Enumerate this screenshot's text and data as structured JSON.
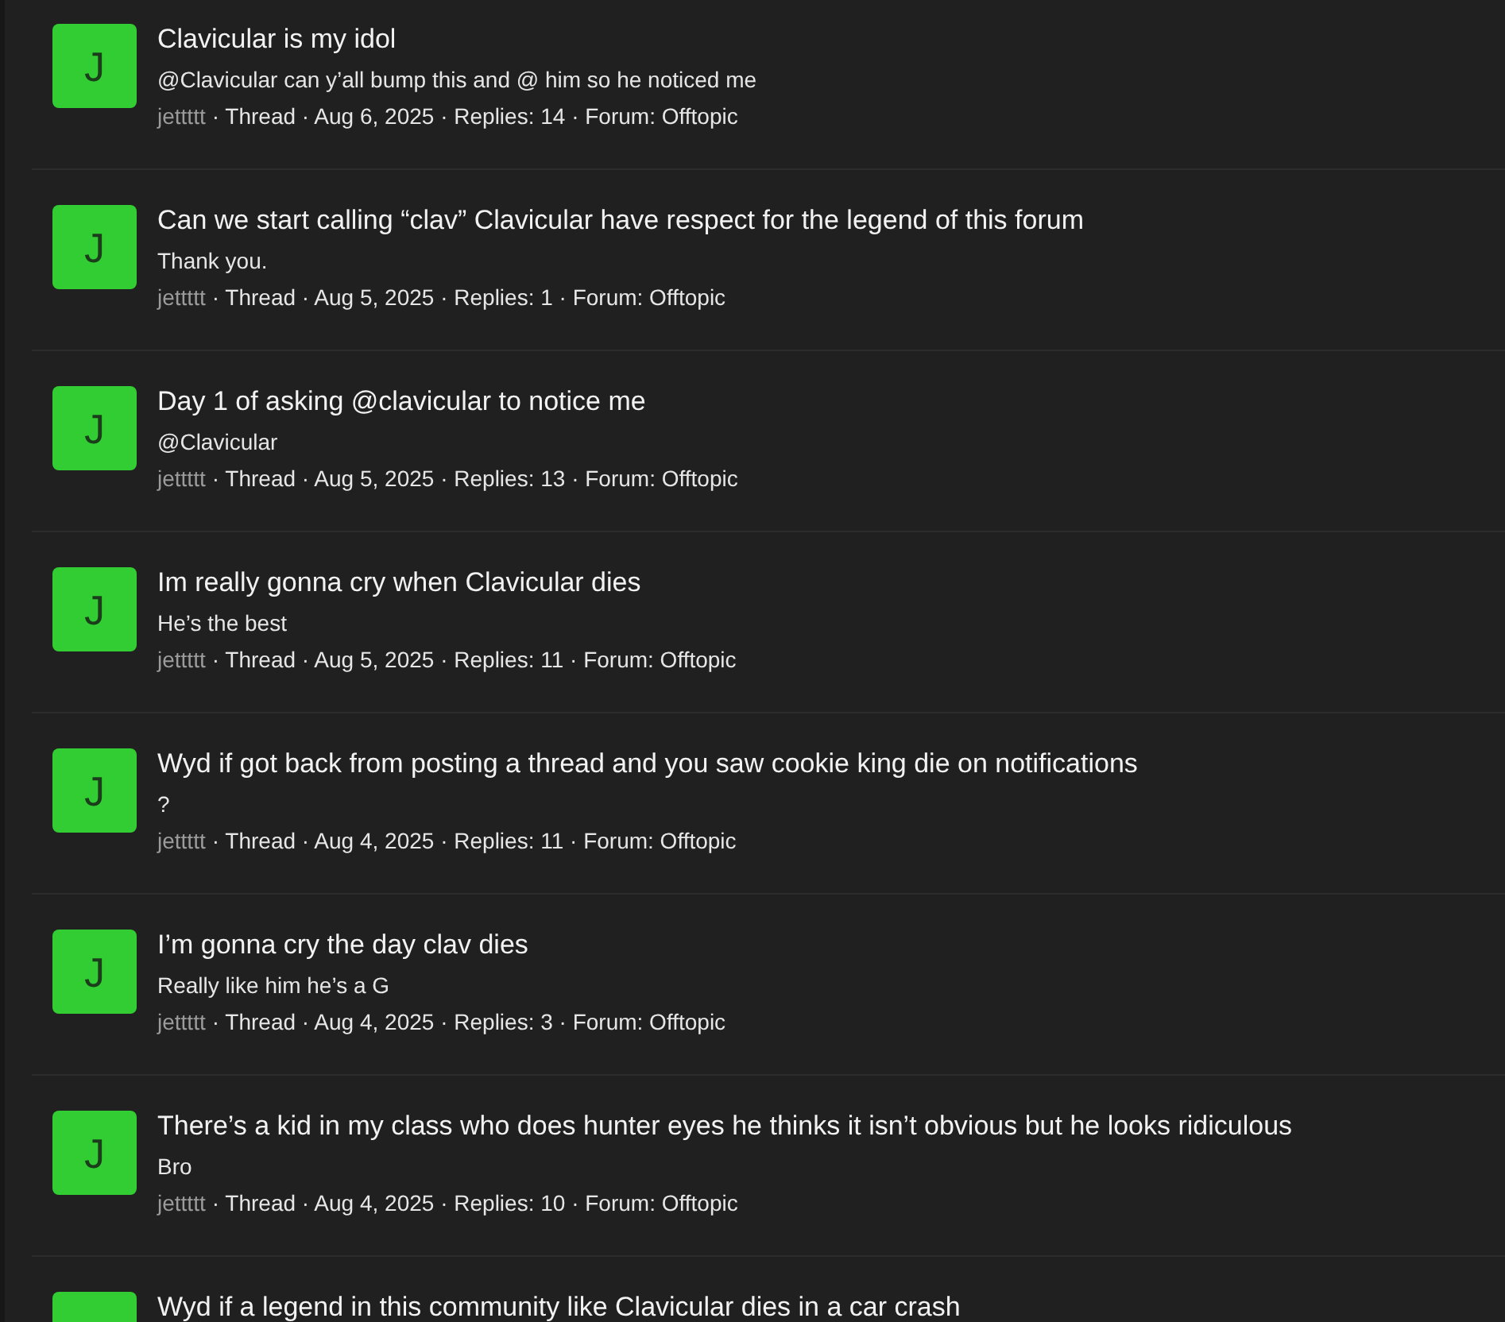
{
  "threads": [
    {
      "avatar_letter": "J",
      "title": "Clavicular is my idol",
      "snippet": "@Clavicular can y’all bump this and @ him so he noticed me",
      "author": "jettttt",
      "details": "· Thread · Aug 6, 2025 · Replies: 14 · Forum: Offtopic"
    },
    {
      "avatar_letter": "J",
      "title": "Can we start calling “clav” Clavicular have respect for the legend of this forum",
      "snippet": "Thank you.",
      "author": "jettttt",
      "details": "· Thread · Aug 5, 2025 · Replies: 1 · Forum: Offtopic"
    },
    {
      "avatar_letter": "J",
      "title": "Day 1 of asking @clavicular to notice me",
      "snippet": "@Clavicular",
      "author": "jettttt",
      "details": "· Thread · Aug 5, 2025 · Replies: 13 · Forum: Offtopic"
    },
    {
      "avatar_letter": "J",
      "title": "Im really gonna cry when Clavicular dies",
      "snippet": "He’s the best",
      "author": "jettttt",
      "details": "· Thread · Aug 5, 2025 · Replies: 11 · Forum: Offtopic"
    },
    {
      "avatar_letter": "J",
      "title": "Wyd if got back from posting a thread and you saw cookie king die on notifications",
      "snippet": "?",
      "author": "jettttt",
      "details": "· Thread · Aug 4, 2025 · Replies: 11 · Forum: Offtopic"
    },
    {
      "avatar_letter": "J",
      "title": "I’m gonna cry the day clav dies",
      "snippet": "Really like him he’s a G",
      "author": "jettttt",
      "details": "· Thread · Aug 4, 2025 · Replies: 3 · Forum: Offtopic"
    },
    {
      "avatar_letter": "J",
      "title": "There’s a kid in my class who does hunter eyes he thinks it isn’t obvious but he looks ridiculous",
      "snippet": "Bro",
      "author": "jettttt",
      "details": "· Thread · Aug 4, 2025 · Replies: 10 · Forum: Offtopic"
    },
    {
      "title": "Wyd if a legend in this community like Clavicular dies in a car crash"
    }
  ]
}
